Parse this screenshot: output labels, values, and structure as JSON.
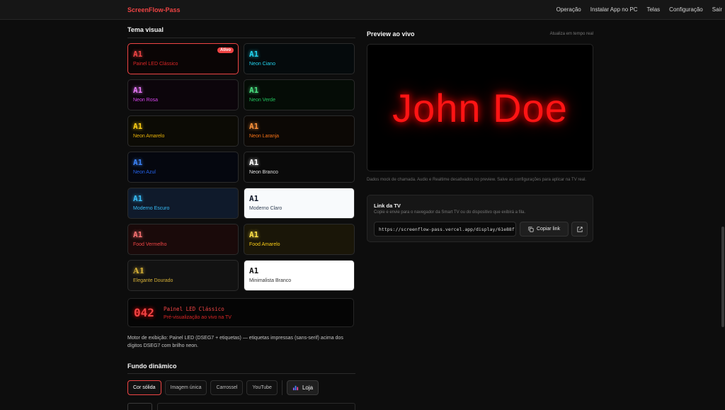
{
  "header": {
    "brand": "ScreenFlow-Pass",
    "nav": [
      "Operação",
      "Instalar App no PC",
      "Telas",
      "Configuração",
      "Sair"
    ]
  },
  "tema": {
    "title": "Tema visual",
    "active_badge": "Ativo",
    "themes": [
      {
        "sample": "A1",
        "name": "Painel LED Clássico",
        "bg": "#0a0505",
        "color": "#ef4444",
        "name_color": "#dc2626"
      },
      {
        "sample": "A1",
        "name": "Neon Ciano",
        "bg": "#050a0c",
        "color": "#22d3ee",
        "name_color": "#22d3ee"
      },
      {
        "sample": "A1",
        "name": "Neon Rosa",
        "bg": "#0c050b",
        "color": "#e879f9",
        "name_color": "#d946ef"
      },
      {
        "sample": "A1",
        "name": "Neon Verde",
        "bg": "#050c06",
        "color": "#4ade80",
        "name_color": "#22c55e"
      },
      {
        "sample": "A1",
        "name": "Neon Amarelo",
        "bg": "#0c0b05",
        "color": "#facc15",
        "name_color": "#eab308"
      },
      {
        "sample": "A1",
        "name": "Neon Laranja",
        "bg": "#0c0805",
        "color": "#fb923c",
        "name_color": "#f97316"
      },
      {
        "sample": "A1",
        "name": "Neon Azul",
        "bg": "#05070f",
        "color": "#3b82f6",
        "name_color": "#2563eb"
      },
      {
        "sample": "A1",
        "name": "Neon Branco",
        "bg": "#0a0a0a",
        "color": "#ffffff",
        "name_color": "#e5e5e5"
      },
      {
        "sample": "A1",
        "name": "Moderno Escuro",
        "bg": "#0f1a2b",
        "color": "#38bdf8",
        "name_color": "#38bdf8"
      },
      {
        "sample": "A1",
        "name": "Moderno Claro",
        "bg": "#f8fafc",
        "color": "#0f172a",
        "name_color": "#334155"
      },
      {
        "sample": "A1",
        "name": "Food Vermelho",
        "bg": "#1a0a0a",
        "color": "#f87171",
        "name_color": "#ef4444"
      },
      {
        "sample": "A1",
        "name": "Food Amarelo",
        "bg": "#1a1608",
        "color": "#fde047",
        "name_color": "#facc15"
      },
      {
        "sample": "A1",
        "name": "Elegante Dourado",
        "bg": "#121212",
        "color": "#d4af37",
        "name_color": "#d4af37"
      },
      {
        "sample": "A1",
        "name": "Minimalista Branco",
        "bg": "#ffffff",
        "color": "#111111",
        "name_color": "#333333"
      }
    ]
  },
  "preview_strip": {
    "number": "042",
    "name": "Painel LED Clássico",
    "subtitle": "Pré-visualização ao vivo na TV"
  },
  "engine_note": "Motor de exibição: Painel LED (DSEG7 + etiquetas) — etiquetas impressas (sans-serif) acima dos dígitos DSEG7 com brilho neon.",
  "fundo": {
    "title": "Fundo dinâmico",
    "options": [
      "Cor sólida",
      "Imagem única",
      "Carrossel",
      "YouTube"
    ],
    "store_label": "Loja"
  },
  "preview": {
    "title": "Preview ao vivo",
    "note": "Atualiza em tempo real",
    "name": "John Doe",
    "mock_note": "Dados mock de chamada. Audio e Realtime desativados no preview. Salve as configurações para aplicar na TV real."
  },
  "tv_link": {
    "title": "Link da TV",
    "description": "Copie e envie para o navegador da Smart TV ou do dispositivo que exibirá a fila.",
    "url": "https://screenflow-pass.vercel.app/display/61e88f",
    "copy_label": "Copiar link"
  },
  "colors": {
    "accent": "#ef4444",
    "background": "#0d0d0d"
  }
}
